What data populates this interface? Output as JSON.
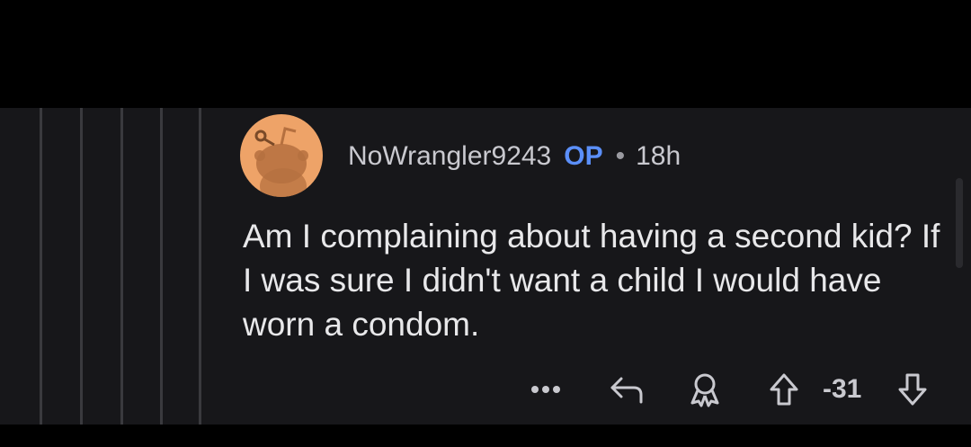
{
  "comment": {
    "author": "NoWrangler9243",
    "op_badge": "OP",
    "separator": "•",
    "age": "18h",
    "body": "Am I complaining about having a second kid? If I was sure I didn't want a child I would have worn a condom.",
    "score": "-31",
    "avatar_color": "#eea368"
  },
  "actions": {
    "more_icon": "more-options-icon",
    "reply_icon": "reply-icon",
    "award_icon": "award-icon",
    "upvote_icon": "upvote-icon",
    "downvote_icon": "downvote-icon"
  },
  "colors": {
    "panel_bg": "#17171a",
    "thread_line": "#3a3a3e",
    "op_blue": "#5b8ff9",
    "text": "#e8e8ea"
  }
}
